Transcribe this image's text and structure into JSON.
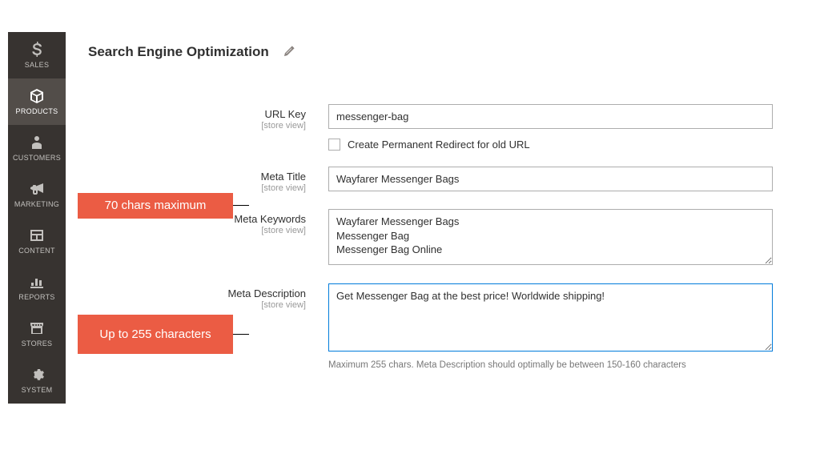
{
  "sidebar": {
    "items": [
      {
        "label": "SALES",
        "icon": "dollar-icon",
        "active": false
      },
      {
        "label": "PRODUCTS",
        "icon": "cube-icon",
        "active": true
      },
      {
        "label": "CUSTOMERS",
        "icon": "person-icon",
        "active": false
      },
      {
        "label": "MARKETING",
        "icon": "bullhorn-icon",
        "active": false
      },
      {
        "label": "CONTENT",
        "icon": "layout-icon",
        "active": false
      },
      {
        "label": "REPORTS",
        "icon": "barchart-icon",
        "active": false
      },
      {
        "label": "STORES",
        "icon": "store-icon",
        "active": false
      },
      {
        "label": "SYSTEM",
        "icon": "gear-icon",
        "active": false
      }
    ]
  },
  "section": {
    "title": "Search Engine Optimization"
  },
  "fields": {
    "url_key": {
      "label": "URL Key",
      "scope": "[store view]",
      "value": "messenger-bag"
    },
    "redirect_cb": {
      "label": "Create Permanent Redirect for old URL"
    },
    "meta_title": {
      "label": "Meta Title",
      "scope": "[store view]",
      "value": "Wayfarer Messenger Bags"
    },
    "meta_keywords": {
      "label": "Meta Keywords",
      "scope": "[store view]",
      "value": "Wayfarer Messenger Bags\nMessenger Bag\nMessenger Bag Online"
    },
    "meta_description": {
      "label": "Meta Description",
      "scope": "[store view]",
      "value": "Get Messenger Bag at the best price! Worldwide shipping!",
      "hint": "Maximum 255 chars. Meta Description should optimally be between 150-160 characters"
    }
  },
  "callouts": {
    "meta_title": "70 chars maximum",
    "meta_description": "Up to 255 characters"
  }
}
